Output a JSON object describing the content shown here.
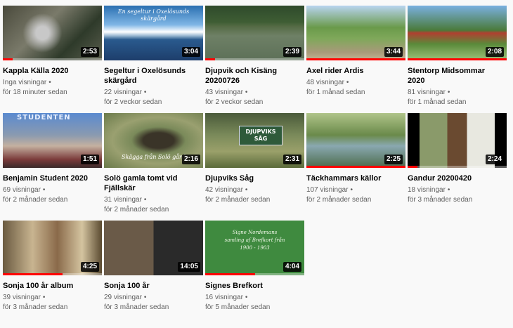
{
  "videos": [
    {
      "title": "Kappla Källa 2020",
      "views": "Inga visningar",
      "age": "för 18 minuter sedan",
      "duration": "2:53",
      "watched": 0.1
    },
    {
      "title": "Segeltur i Oxelösunds skärgård",
      "views": "22 visningar",
      "age": "för 2 veckor sedan",
      "duration": "3:04",
      "watched": 0.0,
      "thumb_text": "En segeltur i Oxelösunds skärgård"
    },
    {
      "title": "Djupvik och Kisäng 20200726",
      "views": "43 visningar",
      "age": "för 2 veckor sedan",
      "duration": "2:39",
      "watched": 0.1
    },
    {
      "title": "Axel rider Ardis",
      "views": "48 visningar",
      "age": "för 1 månad sedan",
      "duration": "3:44",
      "watched": 1.0
    },
    {
      "title": "Stentorp Midsommar 2020",
      "views": "81 visningar",
      "age": "för 1 månad sedan",
      "duration": "2:08",
      "watched": 1.0
    },
    {
      "title": "Benjamin Student 2020",
      "views": "69 visningar",
      "age": "för 2 månader sedan",
      "duration": "1:51",
      "watched": 0.0,
      "thumb_text": "STUDENTEN"
    },
    {
      "title": "Solö gamla tomt vid Fjällskär",
      "views": "31 visningar",
      "age": "för 2 månader sedan",
      "duration": "2:16",
      "watched": 0.0,
      "thumb_text": "Skägga från Solö gård"
    },
    {
      "title": "Djupviks Såg",
      "views": "42 visningar",
      "age": "för 2 månader sedan",
      "duration": "2:31",
      "watched": 0.0,
      "thumb_text": "DJUPVIKS SÅG"
    },
    {
      "title": "Täckhammars källor",
      "views": "107 visningar",
      "age": "för 2 månader sedan",
      "duration": "2:25",
      "watched": 1.0
    },
    {
      "title": "Gandur 20200420",
      "views": "18 visningar",
      "age": "för 3 månader sedan",
      "duration": "2:24",
      "watched": 0.1
    },
    {
      "title": "Sonja 100 år album",
      "views": "39 visningar",
      "age": "för 3 månader sedan",
      "duration": "4:25",
      "watched": 0.6
    },
    {
      "title": "Sonja 100 år",
      "views": "29 visningar",
      "age": "för 3 månader sedan",
      "duration": "14:05",
      "watched": 0.0
    },
    {
      "title": "Signes Brefkort",
      "views": "16 visningar",
      "age": "för 5 månader sedan",
      "duration": "4:04",
      "watched": 0.5,
      "thumb_text": "Signe Nordemans samling af Brefkort från 1900 - 1903"
    }
  ],
  "separator": "•",
  "colors": {
    "progress": "#ff0000",
    "meta": "#606060",
    "title": "#030303"
  }
}
